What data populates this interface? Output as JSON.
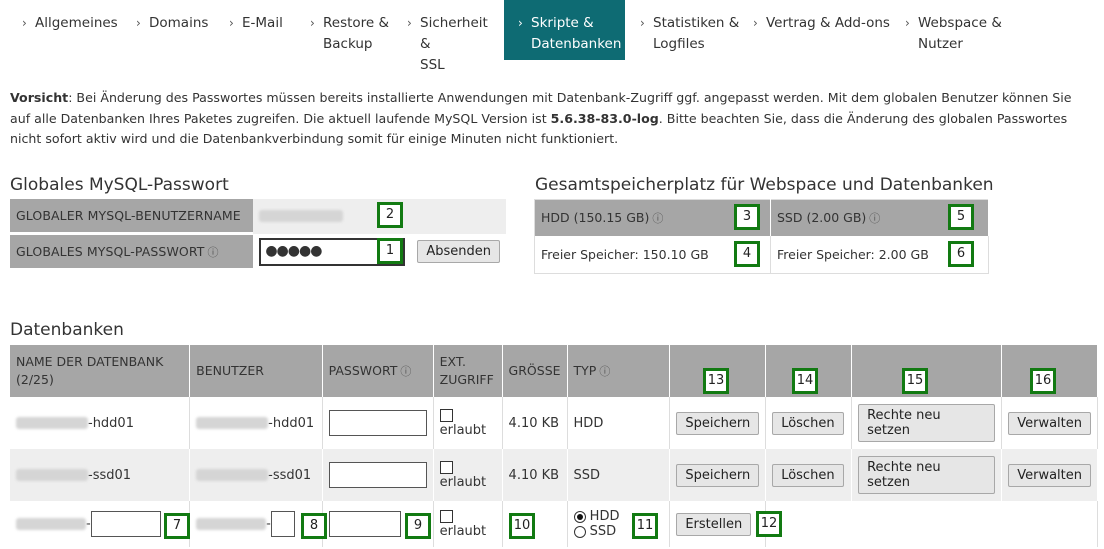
{
  "tabs": [
    {
      "line1": "Allgemeines",
      "line2": ""
    },
    {
      "line1": "Domains",
      "line2": ""
    },
    {
      "line1": "E-Mail",
      "line2": ""
    },
    {
      "line1": "Restore &",
      "line2": "Backup"
    },
    {
      "line1": "Sicherheit &",
      "line2": "SSL"
    },
    {
      "line1": "Skripte &",
      "line2": "Datenbanken"
    },
    {
      "line1": "Statistiken &",
      "line2": "Logfiles"
    },
    {
      "line1": "Vertrag & Add-ons",
      "line2": ""
    },
    {
      "line1": "Webspace &",
      "line2": "Nutzer"
    }
  ],
  "intro": {
    "bold1": "Vorsicht",
    "text1": ": Bei Änderung des Passwortes müssen bereits installierte Anwendungen mit Datenbank-Zugriff ggf. angepasst werden. Mit dem globalen Benutzer können Sie auf alle Datenbanken Ihres Paketes zugreifen. Die aktuell laufende MySQL Version ist ",
    "version": "5.6.38-83.0-log",
    "text2": ". Bitte beachten Sie, dass die Änderung des globalen Passwortes nicht sofort aktiv wird und die Datenbankverbindung somit für einige Minuten nicht funktioniert."
  },
  "mysql": {
    "title": "Globales MySQL-Passwort",
    "user_label": "GLOBALER MYSQL-BENUTZERNAME",
    "pw_label": "GLOBALES MYSQL-PASSWORT",
    "pw_value": "●●●●●",
    "submit": "Absenden"
  },
  "storage": {
    "title": "Gesamtspeicherplatz für Webspace und Datenbanken",
    "hdd_label": "HDD (150.15 GB)",
    "ssd_label": "SSD (2.00 GB)",
    "hdd_free": "Freier Speicher: 150.10 GB",
    "ssd_free": "Freier Speicher: 2.00 GB"
  },
  "databases": {
    "title": "Datenbanken",
    "headers": {
      "name": "NAME DER DATENBANK (2/25)",
      "user": "BENUTZER",
      "password": "PASSWORT",
      "ext_line1": "EXT.",
      "ext_line2": "ZUGRIFF",
      "size": "GRÖSSE",
      "type": "TYP"
    },
    "rows": [
      {
        "name_suffix": "-hdd01",
        "user_suffix": "-hdd01",
        "ext_label": "erlaubt",
        "size": "4.10 KB",
        "type": "HDD",
        "save": "Speichern",
        "delete": "Löschen",
        "reset": "Rechte neu setzen",
        "manage": "Verwalten"
      },
      {
        "name_suffix": "-ssd01",
        "user_suffix": "-ssd01",
        "ext_label": "erlaubt",
        "size": "4.10 KB",
        "type": "SSD",
        "save": "Speichern",
        "delete": "Löschen",
        "reset": "Rechte neu setzen",
        "manage": "Verwalten"
      }
    ],
    "new_row": {
      "name_dash": "-",
      "user_dash": "-",
      "ext_label": "erlaubt",
      "radio_hdd": "HDD",
      "radio_ssd": "SSD",
      "create": "Erstellen"
    }
  },
  "badges": [
    "1",
    "2",
    "3",
    "4",
    "5",
    "6",
    "7",
    "8",
    "9",
    "10",
    "11",
    "12",
    "13",
    "14",
    "15",
    "16"
  ],
  "colors": {
    "active_tab": "#0e6b73",
    "header_bg": "#a6a6a6",
    "badge_border": "#127a12"
  }
}
